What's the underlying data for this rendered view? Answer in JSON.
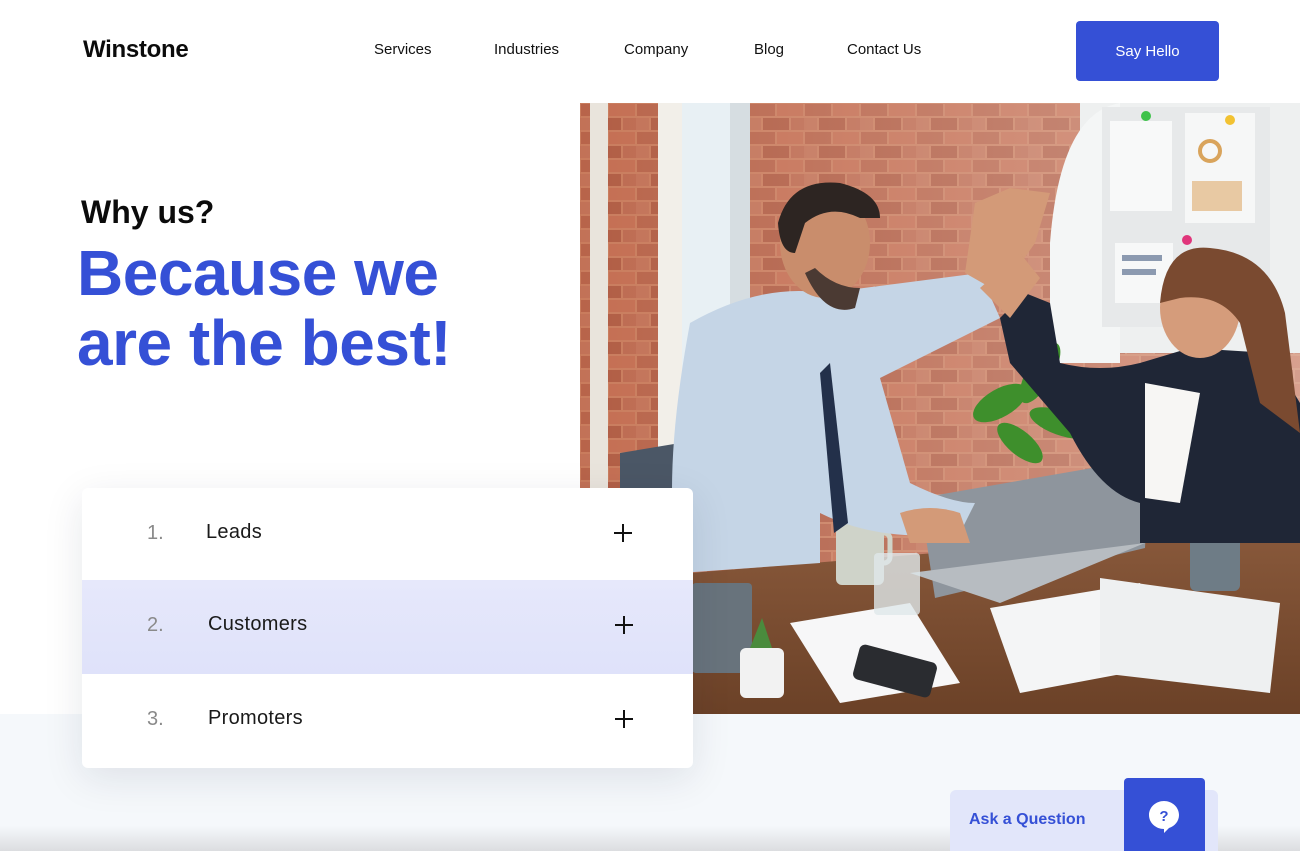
{
  "header": {
    "logo": "Winstone",
    "nav": [
      "Services",
      "Industries",
      "Company",
      "Blog",
      "Contact Us"
    ],
    "cta_label": "Say Hello"
  },
  "hero": {
    "eyebrow": "Why us?",
    "headline_line1": "Because we",
    "headline_line2": "are the best!"
  },
  "accordion": {
    "items": [
      {
        "number": "1.",
        "label": "Leads",
        "expanded": false
      },
      {
        "number": "2.",
        "label": "Customers",
        "expanded": false,
        "highlighted": true
      },
      {
        "number": "3.",
        "label": "Promoters",
        "expanded": false
      }
    ]
  },
  "help_widget": {
    "label": "Ask a Question",
    "icon_glyph": "?"
  },
  "colors": {
    "accent": "#3550d6",
    "highlight_row": "#e2e5fa"
  }
}
